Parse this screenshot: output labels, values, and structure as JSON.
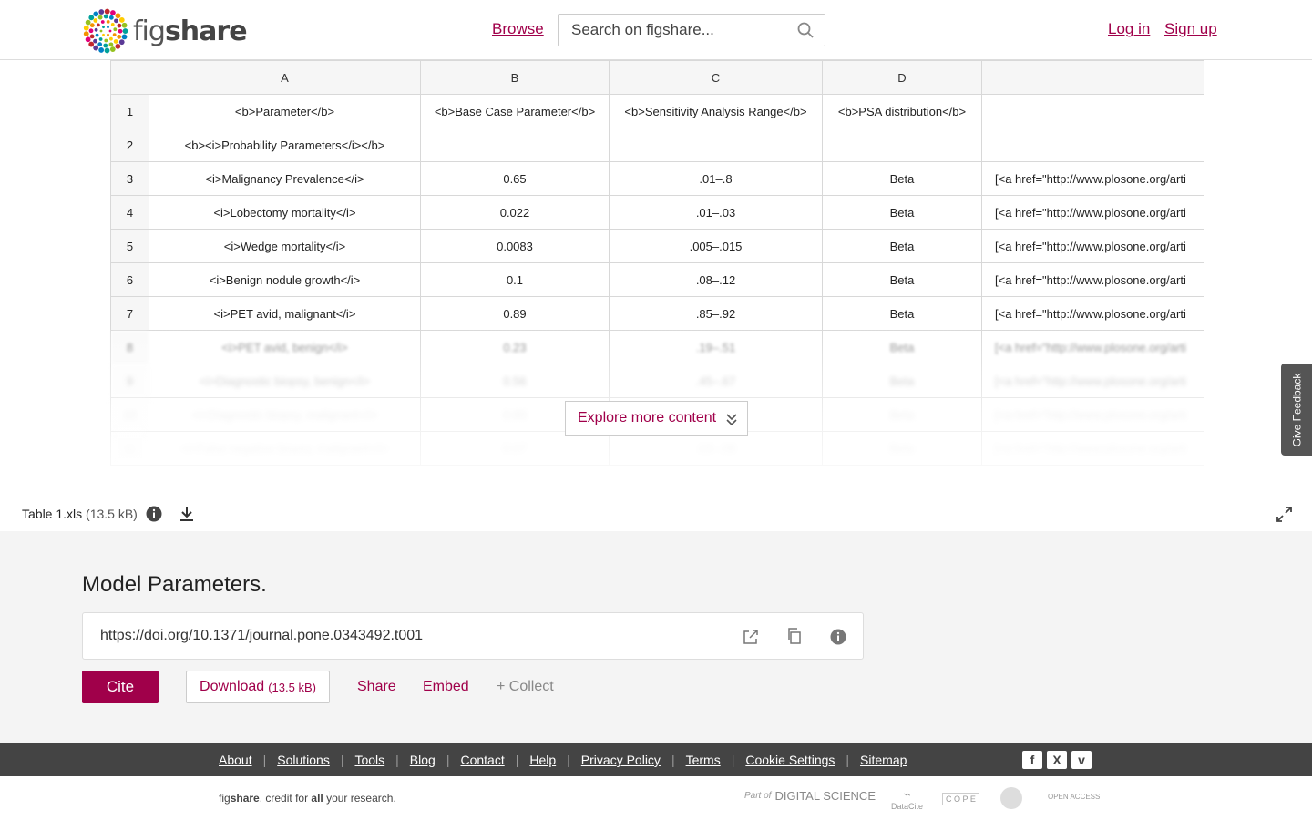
{
  "header": {
    "logo_text_light": "fig",
    "logo_text_bold": "share",
    "browse": "Browse",
    "search_placeholder": "Search on figshare...",
    "login": "Log in",
    "signup": "Sign up"
  },
  "sheet": {
    "columns": [
      "",
      "A",
      "B",
      "C",
      "D",
      ""
    ],
    "rows": [
      [
        "1",
        "<b>Parameter</b>",
        "<b>Base Case Parameter</b>",
        "<b>Sensitivity Analysis Range</b>",
        "<b>PSA distribution</b>",
        ""
      ],
      [
        "2",
        "<b><i>Probability Parameters</i></b>",
        "",
        "",
        "",
        ""
      ],
      [
        "3",
        "<i>Malignancy Prevalence</i>",
        "0.65",
        ".01–.8",
        "Beta",
        "[<a href=\"http://www.plosone.org/arti"
      ],
      [
        "4",
        "<i>Lobectomy mortality</i>",
        "0.022",
        ".01–.03",
        "Beta",
        "[<a href=\"http://www.plosone.org/arti"
      ],
      [
        "5",
        "<i>Wedge mortality</i>",
        "0.0083",
        ".005–.015",
        "Beta",
        "[<a href=\"http://www.plosone.org/arti"
      ],
      [
        "6",
        "<i>Benign nodule growth</i>",
        "0.1",
        ".08–.12",
        "Beta",
        "[<a href=\"http://www.plosone.org/arti"
      ],
      [
        "7",
        "<i>PET avid, malignant</i>",
        "0.89",
        ".85–.92",
        "Beta",
        "[<a href=\"http://www.plosone.org/arti"
      ],
      [
        "8",
        "<i>PET avid, benign</i>",
        "0.23",
        ".19–.51",
        "Beta",
        "[<a href=\"http://www.plosone.org/arti"
      ],
      [
        "9",
        "<i>Diagnostic biopsy, benign</i>",
        "0.56",
        ".45–.67",
        "Beta",
        "[<a href=\"http://www.plosone.org/arti"
      ],
      [
        "10",
        "<i>Diagnostic biopsy, malignant</i>",
        "0.93",
        "",
        "Beta",
        "[<a href=\"http://www.plosone.org/arti"
      ],
      [
        "11",
        "<i>False negative biopsy, malignant</i>",
        "0.07",
        ".03–.09",
        "Beta",
        "[<a href=\"http://www.plosone.org/arti"
      ]
    ],
    "explore": "Explore more content",
    "feedback": "Give Feedback"
  },
  "file": {
    "name": "Table 1.xls",
    "size": "(13.5 kB)"
  },
  "item": {
    "title": "Model Parameters.",
    "doi": "https://doi.org/10.1371/journal.pone.0343492.t001",
    "cite": "Cite",
    "download": "Download",
    "download_size": "(13.5 kB)",
    "share": "Share",
    "embed": "Embed",
    "collect": "+ Collect"
  },
  "footer": {
    "links": [
      "About",
      "Solutions",
      "Tools",
      "Blog",
      "Contact",
      "Help",
      "Privacy Policy",
      "Terms",
      "Cookie Settings",
      "Sitemap"
    ],
    "social": [
      "f",
      "X",
      "v"
    ],
    "tagline_pre": "fig",
    "tagline_bold": "share",
    "tagline_mid": ". credit for ",
    "tagline_all": "all",
    "tagline_post": " your research.",
    "partners": [
      "Part of",
      "DIGITAL SCIENCE",
      "DataCite",
      "C O P E",
      "OPEN ACCESS"
    ]
  },
  "colors": {
    "accent": "#a0004a",
    "footer_bg": "#444444"
  }
}
